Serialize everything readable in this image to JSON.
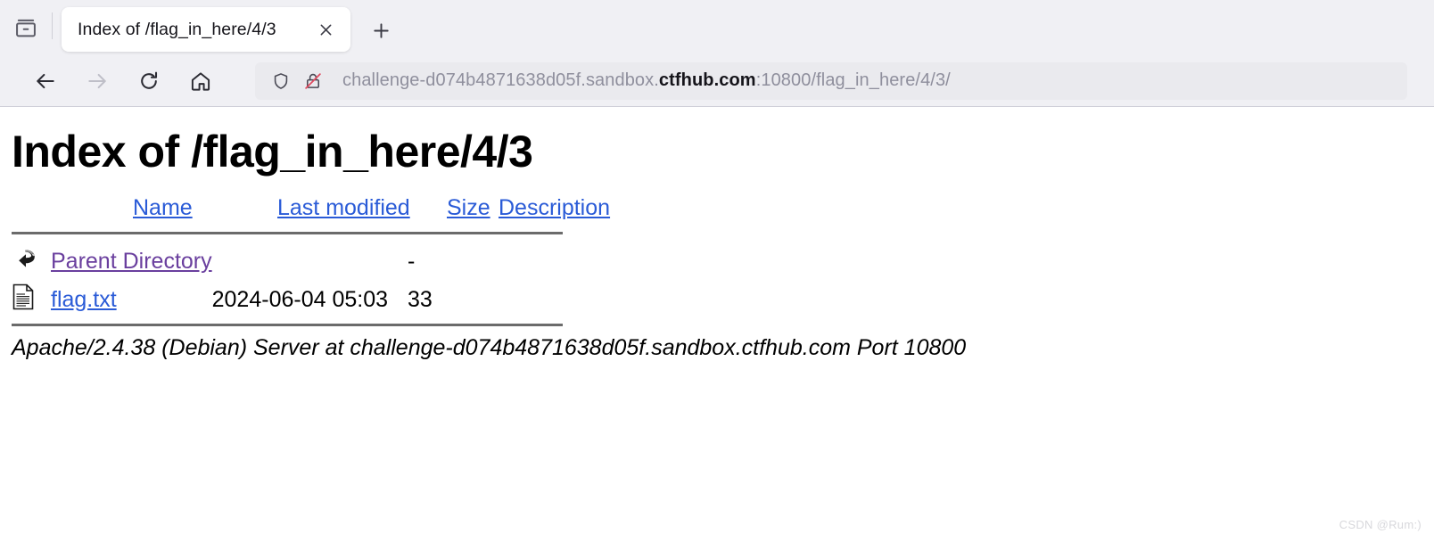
{
  "browser": {
    "tab_list_icon": "tab-archive-icon",
    "tabs": [
      {
        "title": "Index of /flag_in_here/4/3",
        "close_icon": "close-icon"
      }
    ],
    "new_tab_icon": "plus-icon",
    "nav": {
      "back_icon": "arrow-left-icon",
      "forward_icon": "arrow-right-icon",
      "reload_icon": "reload-icon",
      "home_icon": "home-icon"
    },
    "urlbar": {
      "shield_icon": "shield-icon",
      "security_icon": "lock-broken-icon",
      "url_prefix": "challenge-d074b4871638d05f.sandbox.",
      "url_host_strong": "ctfhub.com",
      "url_suffix": ":10800/flag_in_here/4/3/",
      "full_url": "challenge-d074b4871638d05f.sandbox.ctfhub.com:10800/flag_in_here/4/3/"
    }
  },
  "page": {
    "title": "Index of /flag_in_here/4/3",
    "columns": {
      "name": "Name",
      "last_modified": "Last modified",
      "size": "Size",
      "description": "Description"
    },
    "rows": [
      {
        "icon": "parent-directory-icon",
        "name": "Parent Directory",
        "last_modified": "",
        "size": "-",
        "description": ""
      },
      {
        "icon": "text-file-icon",
        "name": "flag.txt",
        "last_modified": "2024-06-04 05:03",
        "size": "33",
        "description": ""
      }
    ],
    "footer": "Apache/2.4.38 (Debian) Server at challenge-d074b4871638d05f.sandbox.ctfhub.com Port 10800",
    "watermark": "CSDN @Rum:)"
  }
}
